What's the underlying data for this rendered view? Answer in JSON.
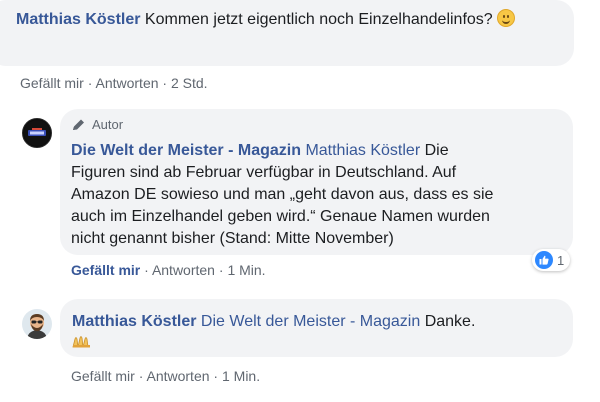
{
  "comment1": {
    "author": "Matthias Köstler",
    "text": "Kommen jetzt eigentlich noch Einzelhandelinfos?",
    "emoji": "smiling-face-emoji",
    "actions": {
      "like": "Gefällt mir",
      "reply": "Antworten",
      "time": "2 Std.",
      "sep": "·"
    }
  },
  "reply1": {
    "badge": "Autor",
    "author": "Die Welt der Meister - Magazin",
    "mention": "Matthias Köstler",
    "text_line1": "Die",
    "text_line2": "Figuren sind ab Februar verfügbar in Deutschland. Auf",
    "text_line3": "Amazon DE sowieso und man „geht davon aus, dass es sie",
    "text_line4": "auch im Einzelhandel geben wird.“ Genaue Namen wurden",
    "text_line5": "nicht genannt bisher (Stand: Mitte November)",
    "reactions": {
      "count": "1"
    },
    "actions": {
      "like": "Gefällt mir",
      "reply": "Antworten",
      "time": "1 Min.",
      "sep": "·"
    }
  },
  "reply2": {
    "author": "Matthias Köstler",
    "mention": "Die Welt der Meister - Magazin",
    "text": "Danke.",
    "emoji": "praying-hands-emoji",
    "actions": {
      "like": "Gefällt mir",
      "reply": "Antworten",
      "time": "1 Min.",
      "sep": "·"
    }
  },
  "colors": {
    "link": "#385898",
    "bubble": "#f2f3f5",
    "meta": "#606770",
    "like_blue": "#2d88ff"
  }
}
